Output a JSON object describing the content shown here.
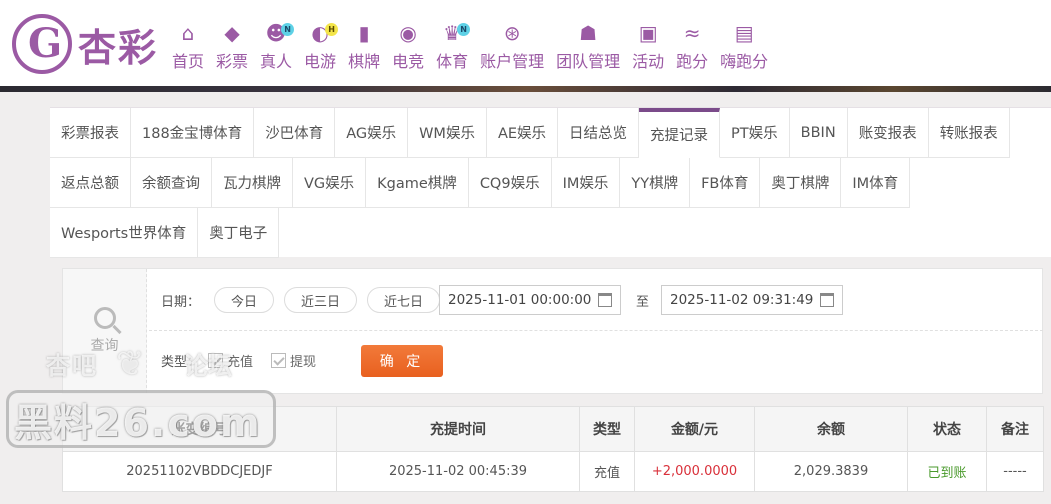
{
  "brand": {
    "name": "杏彩"
  },
  "nav": [
    {
      "label": "首页",
      "icon": "home-icon",
      "badge": ""
    },
    {
      "label": "彩票",
      "icon": "lottery-ticket-icon",
      "badge": ""
    },
    {
      "label": "真人",
      "icon": "live-dealer-icon",
      "badge": "N"
    },
    {
      "label": "电游",
      "icon": "gamepad-icon",
      "badge": "H"
    },
    {
      "label": "棋牌",
      "icon": "cards-icon",
      "badge": ""
    },
    {
      "label": "电竞",
      "icon": "joystick-icon",
      "badge": ""
    },
    {
      "label": "体育",
      "icon": "trophy-icon",
      "badge": "N"
    },
    {
      "label": "账户管理",
      "icon": "account-icon",
      "badge": ""
    },
    {
      "label": "团队管理",
      "icon": "team-icon",
      "badge": ""
    },
    {
      "label": "活动",
      "icon": "gift-icon",
      "badge": ""
    },
    {
      "label": "跑分",
      "icon": "running-dog-icon",
      "badge": ""
    },
    {
      "label": "嗨跑分",
      "icon": "hi-icon",
      "badge": ""
    }
  ],
  "tabs": {
    "row1": [
      "彩票报表",
      "188金宝博体育",
      "沙巴体育",
      "AG娱乐",
      "WM娱乐",
      "AE娱乐",
      "日结总览",
      "充提记录",
      "PT娱乐",
      "BBIN",
      "账变报表",
      "转账报表"
    ],
    "row2": [
      "返点总额",
      "余额查询",
      "瓦力棋牌",
      "VG娱乐",
      "Kgame棋牌",
      "CQ9娱乐",
      "IM娱乐",
      "YY棋牌",
      "FB体育",
      "奥丁棋牌",
      "IM体育"
    ],
    "row3": [
      "Wesports世界体育",
      "奥丁电子"
    ],
    "active": "充提记录"
  },
  "filter": {
    "query_label": "查询",
    "date_label": "日期：",
    "quick_ranges": [
      "今日",
      "近三日",
      "近七日"
    ],
    "start": "2025-11-01 00:00:00",
    "to_label": "至",
    "end": "2025-11-02 09:31:49",
    "type_label": "类型：",
    "types": [
      {
        "label": "充值",
        "checked": true
      },
      {
        "label": "提现",
        "checked": true
      }
    ],
    "confirm": "确 定"
  },
  "table": {
    "headers": [
      "账变编号",
      "充提时间",
      "类型",
      "金额/元",
      "余额",
      "状态",
      "备注"
    ],
    "rows": [
      [
        "20251102VBDDCJEDJF",
        "2025-11-02 00:45:39",
        "充值",
        "+2,000.0000",
        "2,029.3839",
        "已到账",
        "-----"
      ]
    ]
  },
  "watermark": {
    "line1_left": "杏吧",
    "line1_right": "论坛",
    "line2": "黑料26.com"
  },
  "colors": {
    "brand": "#9b5aa4",
    "confirm": "#e8601f",
    "amount": "#d9303a",
    "status_ok": "#4a9a2c"
  }
}
